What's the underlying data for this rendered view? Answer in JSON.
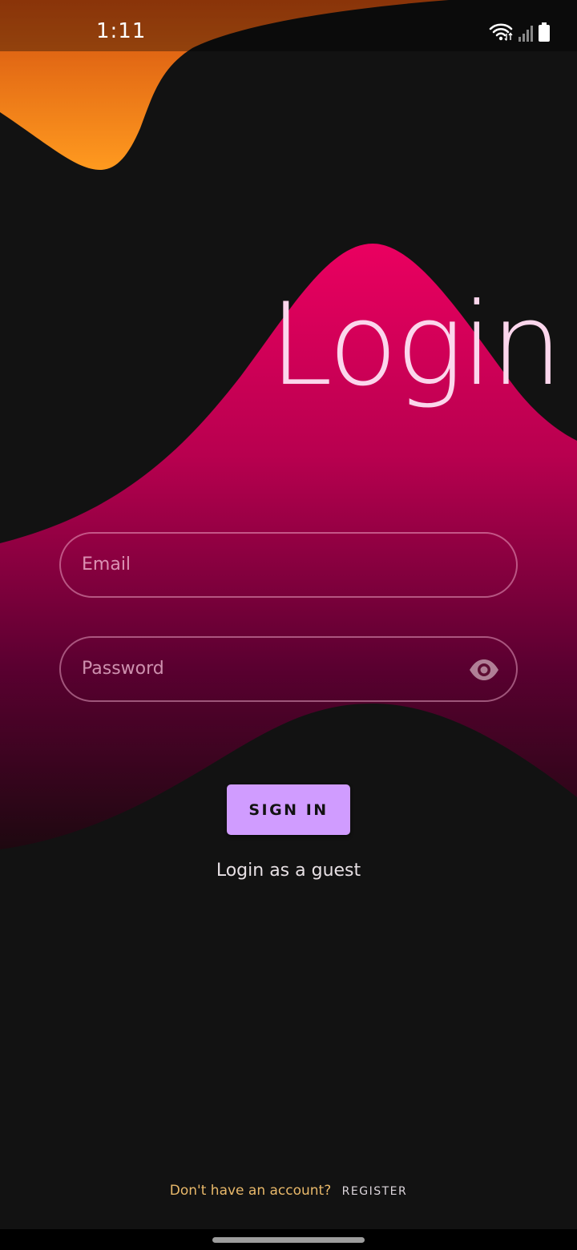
{
  "status_bar": {
    "time": "1:11",
    "icons": [
      "wifi-icon",
      "signal-icon",
      "battery-icon"
    ]
  },
  "title": "Login",
  "form": {
    "email_placeholder": "Email",
    "password_placeholder": "Password",
    "password_toggle_icon": "eye-icon",
    "sign_in_label": "SIGN IN",
    "guest_link": "Login as a guest"
  },
  "footer": {
    "question": "Don't have an account?",
    "register_label": "REGISTER"
  },
  "colors": {
    "background": "#121212",
    "orange_blob": "#ff9a1f",
    "pink_blob_top": "#e8005c",
    "pink_blob_bottom": "#2a0414",
    "button": "#d09cff",
    "question_text": "#e8b86a"
  }
}
